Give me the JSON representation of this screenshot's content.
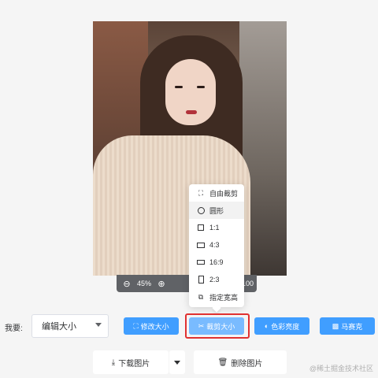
{
  "zoom": {
    "minus_icon": "zoom-out-icon",
    "value": "45%",
    "plus_icon": "zoom-in-icon",
    "dimension": "1100"
  },
  "crop_menu": {
    "items": [
      {
        "label": "自由裁剪",
        "icon": "free-crop-icon"
      },
      {
        "label": "圆形",
        "icon": "circle-icon"
      },
      {
        "label": "1:1",
        "icon": "square-icon"
      },
      {
        "label": "4:3",
        "icon": "rect-4-3-icon"
      },
      {
        "label": "16:9",
        "icon": "rect-16-9-icon"
      },
      {
        "label": "2:3",
        "icon": "rect-2-3-icon"
      },
      {
        "label": "指定宽高",
        "icon": "custom-size-icon"
      }
    ],
    "active_index": 1
  },
  "toolbar": {
    "want_label": "我要:",
    "select_value": "编辑大小",
    "resize_label": "修改大小",
    "crop_label": "裁剪大小",
    "color_label": "色彩亮度",
    "mosaic_label": "马赛克"
  },
  "actions": {
    "download_label": "下载图片",
    "delete_label": "删除图片"
  },
  "watermark": "@稀土掘金技术社区",
  "colors": {
    "primary": "#409eff",
    "primary_light": "#79bbff",
    "highlight": "#e03131"
  }
}
